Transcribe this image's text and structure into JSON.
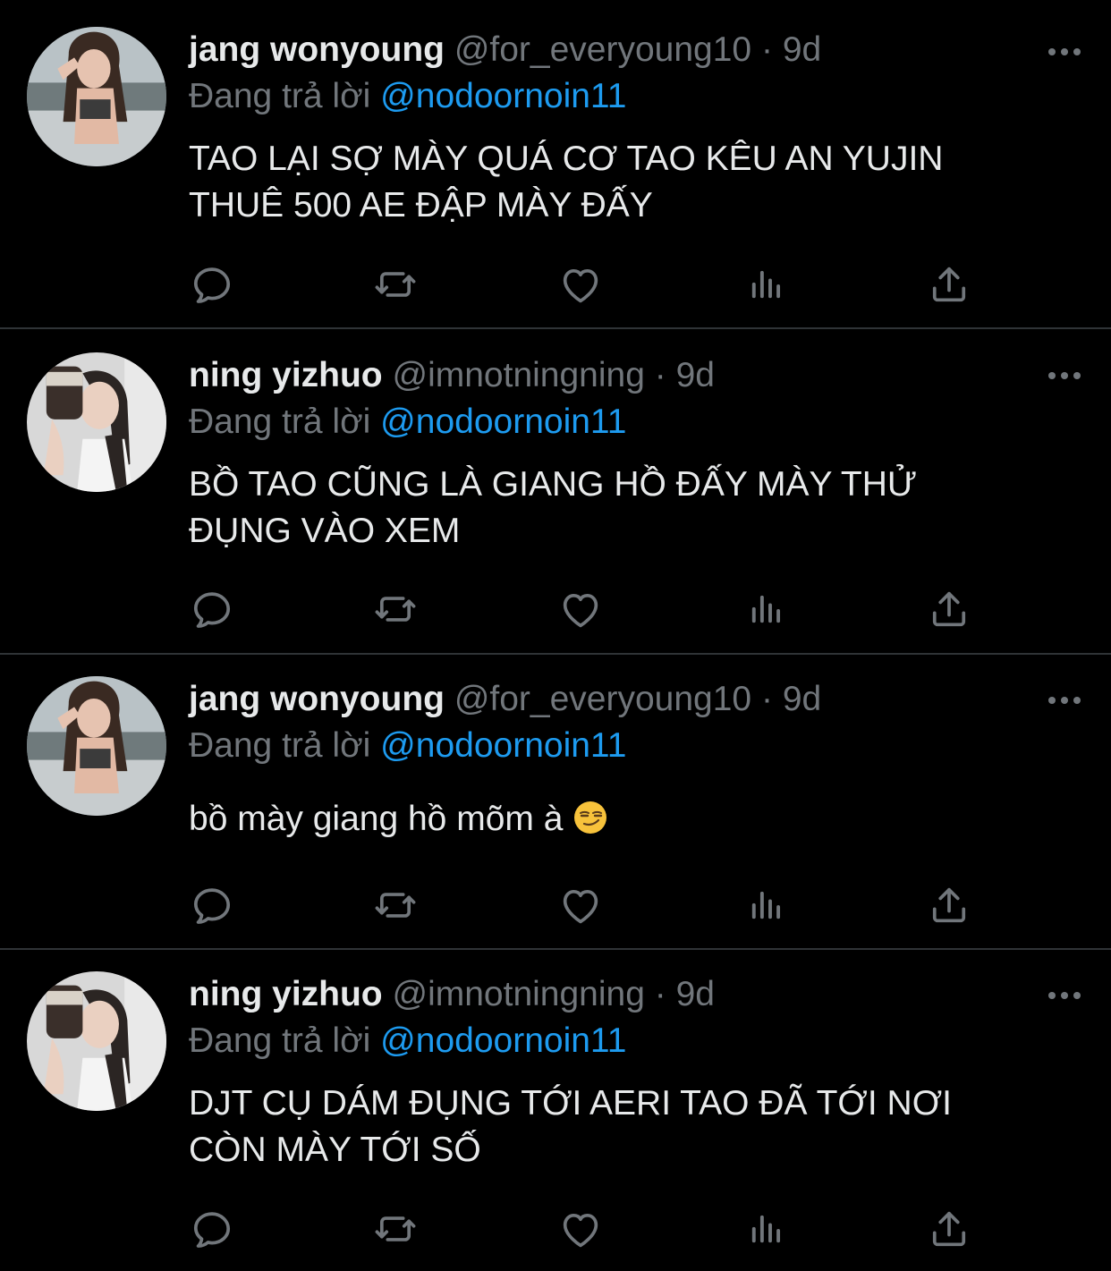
{
  "reply_prefix": "Đang trả lời",
  "tweets": [
    {
      "name": "jang wonyoung",
      "handle": "@for_everyoung10",
      "sep": "·",
      "time": "9d",
      "reply_to": "@nodoornoin11",
      "text_line1": "TAO LẠI SỢ MÀY QUÁ CƠ TAO KÊU AN YUJIN",
      "text_line2": "THUÊ 500 AE ĐẬP MÀY ĐẤY"
    },
    {
      "name": "ning yizhuo",
      "handle": "@imnotningning",
      "sep": "·",
      "time": "9d",
      "reply_to": "@nodoornoin11",
      "text_line1": "BỒ TAO CŨNG LÀ GIANG HỒ ĐẤY MÀY THỬ",
      "text_line2": "ĐỤNG VÀO XEM"
    },
    {
      "name": "jang wonyoung",
      "handle": "@for_everyoung10",
      "sep": "·",
      "time": "9d",
      "reply_to": "@nodoornoin11",
      "text_line1": "bồ mày giang hồ mõm à",
      "emoji": "smirking-face-emoji"
    },
    {
      "name": "ning yizhuo",
      "handle": "@imnotningning",
      "sep": "·",
      "time": "9d",
      "reply_to": "@nodoornoin11",
      "text_line1": "DJT CỤ DÁM ĐỤNG TỚI AERI TAO ĐÃ TỚI NƠI",
      "text_line2": "CÒN MÀY TỚI SỐ"
    }
  ],
  "icons": {
    "reply": "reply-icon",
    "retweet": "retweet-icon",
    "like": "heart-icon",
    "analytics": "analytics-icon",
    "share": "share-icon",
    "more": "more-options-icon"
  },
  "colors": {
    "background": "#000000",
    "text": "#e7e9ea",
    "secondary": "#71767b",
    "mention": "#1d9bf0",
    "divider": "#2f3336"
  }
}
